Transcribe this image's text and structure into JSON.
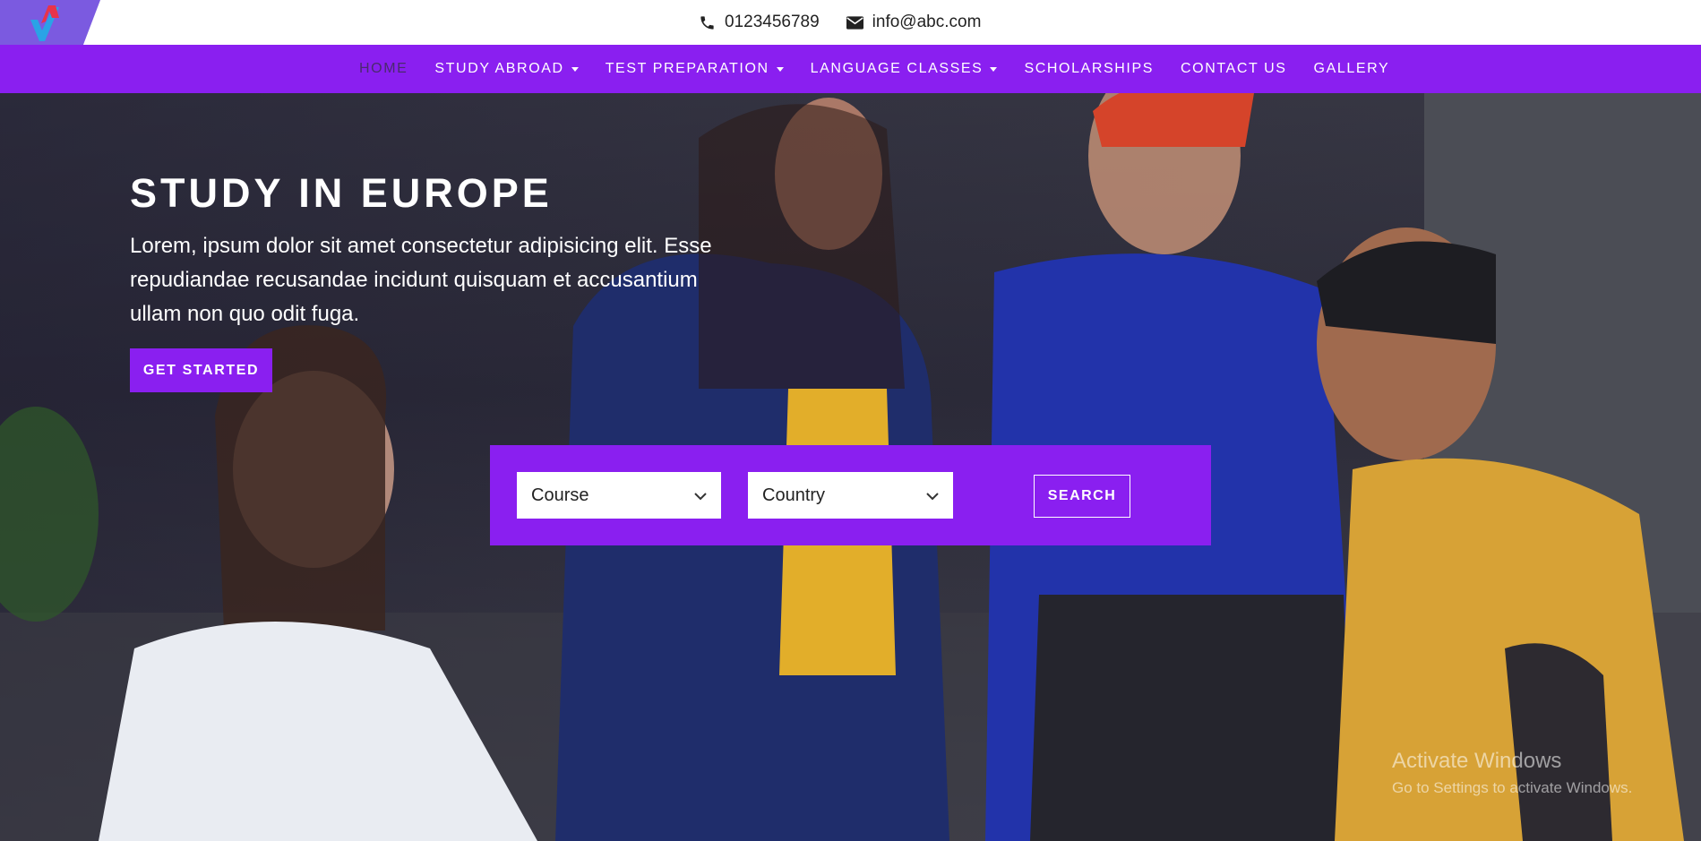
{
  "topbar": {
    "phone": "0123456789",
    "email": "info@abc.com",
    "icons": [
      "phone-icon",
      "envelope-icon"
    ]
  },
  "nav": {
    "items": [
      {
        "label": "HOME",
        "active": true,
        "dropdown": false
      },
      {
        "label": "STUDY ABROAD",
        "active": false,
        "dropdown": true
      },
      {
        "label": "TEST PREPARATION",
        "active": false,
        "dropdown": true
      },
      {
        "label": "LANGUAGE CLASSES",
        "active": false,
        "dropdown": true
      },
      {
        "label": "SCHOLARSHIPS",
        "active": false,
        "dropdown": false
      },
      {
        "label": "CONTACT US",
        "active": false,
        "dropdown": false
      },
      {
        "label": "GALLERY",
        "active": false,
        "dropdown": false
      }
    ]
  },
  "hero": {
    "title": "STUDY IN EUROPE",
    "text": "Lorem, ipsum dolor sit amet consectetur adipisicing elit. Esse repudiandae recusandae incidunt quisquam et accusantium ullam non quo odit fuga.",
    "cta_label": "GET STARTED"
  },
  "search": {
    "course_value": "Course",
    "country_value": "Country",
    "button_label": "SEARCH"
  },
  "watermark": {
    "title": "Activate Windows",
    "subtitle": "Go to Settings to activate Windows."
  },
  "colors": {
    "accent": "#8a1ff0",
    "logo_bg": "#7b5ae0",
    "active_nav": "#4a2a6e",
    "white": "#ffffff"
  }
}
